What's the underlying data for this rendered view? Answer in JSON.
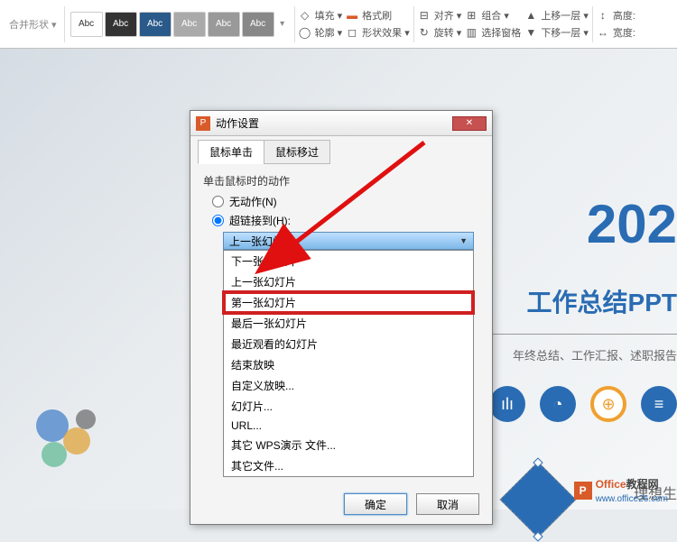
{
  "ribbon": {
    "merge_shape": "合并形状 ▾",
    "style_label": "Abc",
    "fill": "填充 ▾",
    "outline": "轮廓 ▾",
    "format_painter": "格式刷",
    "shape_effect": "形状效果 ▾",
    "align": "对齐 ▾",
    "rotate": "旋转 ▾",
    "group": "组合 ▾",
    "selection_pane": "选择窗格",
    "bring_forward": "上移一层 ▾",
    "send_backward": "下移一层 ▾",
    "height": "高度:",
    "width": "宽度:"
  },
  "slide": {
    "title": "202",
    "subtitle": "工作总结PPT",
    "desc": "年终总结、工作汇报、述职报告",
    "side_text": "理想生"
  },
  "dialog": {
    "title": "动作设置",
    "tab1": "鼠标单击",
    "tab2": "鼠标移过",
    "section_label": "单击鼠标时的动作",
    "radio_none": "无动作(N)",
    "radio_hyperlink": "超链接到(H):",
    "dropdown_selected": "上一张幻灯片",
    "options": [
      "下一张幻灯片",
      "上一张幻灯片",
      "第一张幻灯片",
      "最后一张幻灯片",
      "最近观看的幻灯片",
      "结束放映",
      "自定义放映...",
      "幻灯片...",
      "URL...",
      "其它 WPS演示 文件...",
      "其它文件..."
    ],
    "highlight_index": 2,
    "ok": "确定",
    "cancel": "取消"
  },
  "watermark": {
    "brand_en": "Office",
    "brand_cn": "教程网",
    "url": "www.office26.com"
  }
}
